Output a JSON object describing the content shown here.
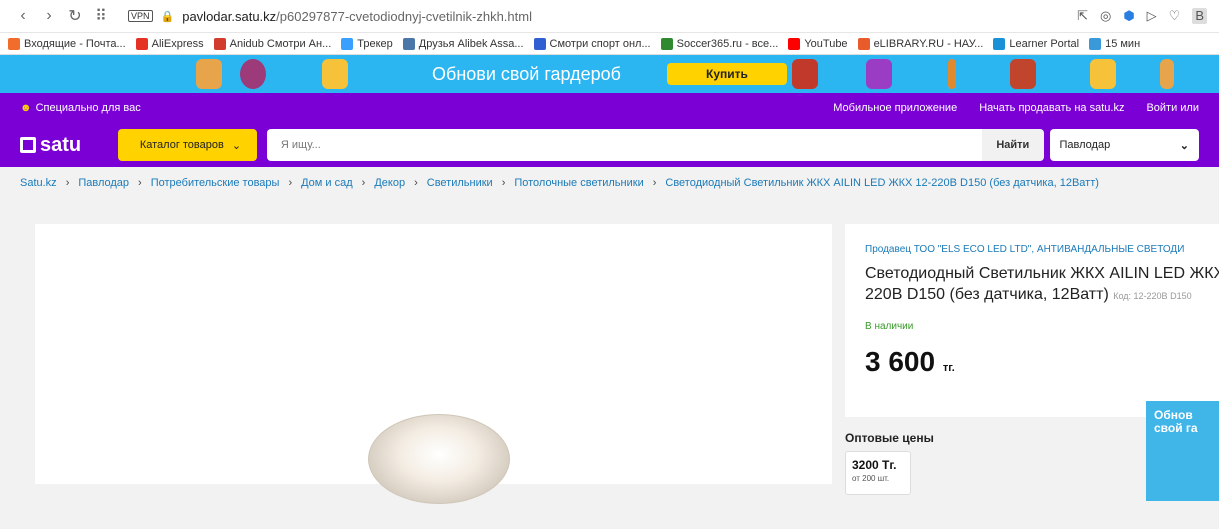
{
  "browser": {
    "url_domain": "pavlodar.satu.kz",
    "url_path": "/p60297877-cvetodiodnyj-cvetilnik-zhkh.html",
    "vpn": "VPN",
    "bookmarks": [
      {
        "label": "Входящие - Почта...",
        "color": "#f26c2c"
      },
      {
        "label": "AliExpress",
        "color": "#e43225"
      },
      {
        "label": "Anidub Смотри Ан...",
        "color": "#d23c2c"
      },
      {
        "label": "Трекер",
        "color": "#3aa0ff"
      },
      {
        "label": "Друзья Alibek Assa...",
        "color": "#4a76a8"
      },
      {
        "label": "Смотри спорт онл...",
        "color": "#2f5fd0"
      },
      {
        "label": "Soccer365.ru - все...",
        "color": "#2f8a2f"
      },
      {
        "label": "YouTube",
        "color": "#ff0000"
      },
      {
        "label": "eLIBRARY.RU - НАУ...",
        "color": "#e85c2c"
      },
      {
        "label": "Learner Portal",
        "color": "#1a90d6"
      },
      {
        "label": "15 мин",
        "color": "#3a9ad9"
      }
    ]
  },
  "promo": {
    "text": "Обнови свой гардероб",
    "button": "Купить"
  },
  "topbar": {
    "special": "Специально для вас",
    "mobile_app": "Мобильное приложение",
    "start_selling": "Начать продавать на satu.kz",
    "login": "Войти или"
  },
  "header": {
    "logo": "satu",
    "catalog": "Каталог товаров",
    "search_placeholder": "Я ищу...",
    "find": "Найти",
    "city": "Павлодар"
  },
  "breadcrumb": [
    "Satu.kz",
    "Павлодар",
    "Потребительские товары",
    "Дом и сад",
    "Декор",
    "Светильники",
    "Потолочные светильники",
    "Светодиодный Светильник ЖКХ AILIN LED ЖКХ 12-220В D150 (без датчика, 12Ватт)"
  ],
  "product": {
    "seller": "Продавец ТОО \"ELS ECO LED LTD\", АНТИВАНДАЛЬНЫЕ СВЕТОДИ",
    "title_line1": "Светодиодный Светильник ЖКХ AILIN LED ЖКХ",
    "title_line2": "220В D150 (без датчика, 12Ватт)",
    "code": "Код: 12-220В D150",
    "stock": "В наличии",
    "price": "3 600",
    "currency": "тг."
  },
  "wholesale": {
    "title": "Оптовые цены",
    "price": "3200 Тг.",
    "qty": "от 200 шт."
  },
  "ad": {
    "text": "Обнов свой га"
  }
}
